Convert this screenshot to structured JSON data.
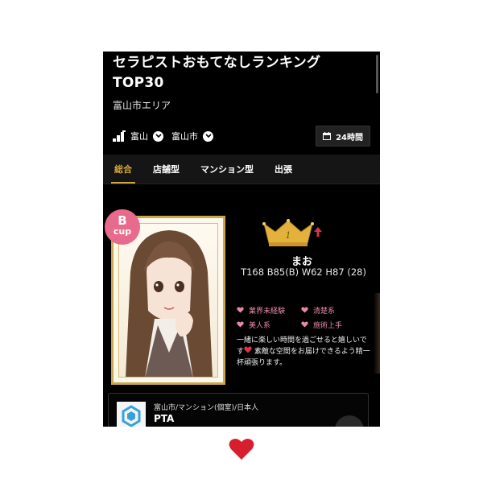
{
  "header": {
    "title_line1": "セラピストおもてなしランキング",
    "title_line2": "TOP30",
    "area": "富山市エリア"
  },
  "location": {
    "prefecture": "富山",
    "city": "富山市",
    "hours_label": "24時間"
  },
  "tabs": [
    {
      "label": "総合",
      "active": true
    },
    {
      "label": "店舗型",
      "active": false
    },
    {
      "label": "マンション型",
      "active": false
    },
    {
      "label": "出張",
      "active": false
    }
  ],
  "therapist": {
    "cup_letter": "B",
    "cup_word": "cup",
    "rank": "1",
    "name": "まお",
    "measurements": "T168 B85(B) W62 H87 (28)",
    "tags": [
      "業界未経験",
      "清楚系",
      "美人系",
      "施術上手"
    ],
    "description_before_heart": "一緒に楽しい時間を過ごせると嬉しいです",
    "description_after_heart": " 素敵な空間をお届けできるよう精一杯頑張ります。"
  },
  "shop": {
    "meta": "富山市/マンション(個室)/日本人",
    "name": "PTA"
  },
  "colors": {
    "accent_gold": "#d4a640",
    "pink": "#e98aa8",
    "badge_pink": "#e86a8c",
    "rank_up_red": "#d6334a",
    "heart_red": "#d81e2e"
  },
  "icons": [
    "stairs-icon",
    "chevron-down-icon",
    "calendar-icon",
    "crown-icon",
    "arrow-up-icon",
    "heart-icon"
  ]
}
